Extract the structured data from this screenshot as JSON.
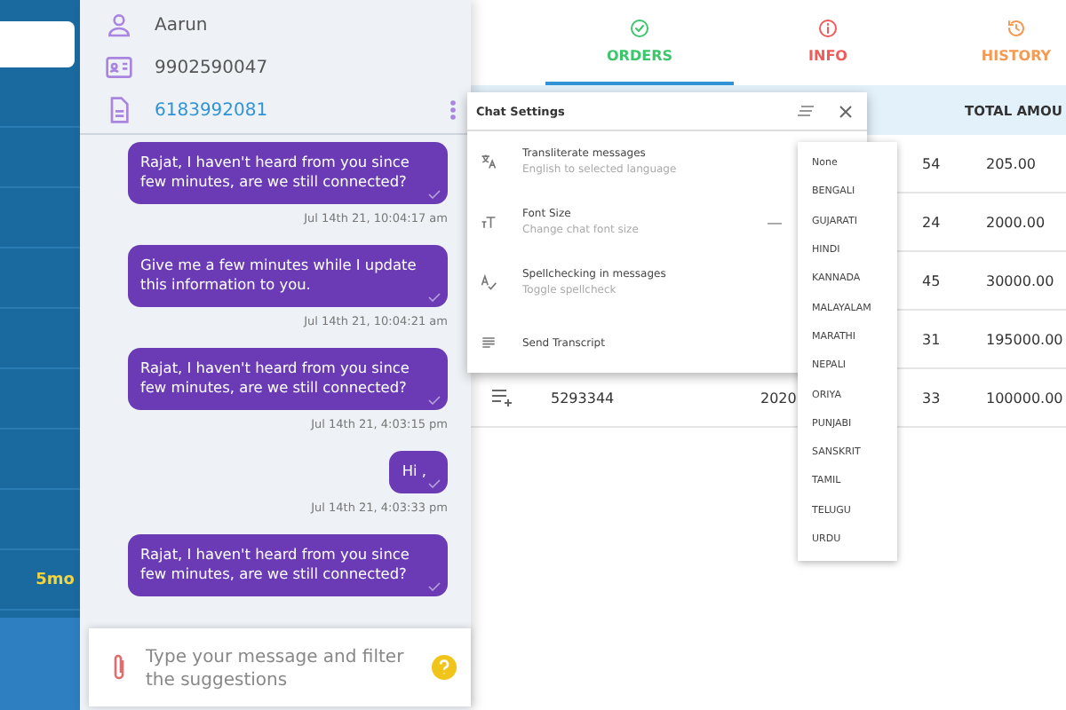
{
  "sidebar": {
    "badge_time": "5mo"
  },
  "contact": {
    "name": "Aarun",
    "phone": "9902590047",
    "account": "6183992081"
  },
  "messages": [
    {
      "text": "Rajat, I haven't heard from you since few minutes, are we still connected?",
      "time": "Jul 14th 21, 10:04:17 am"
    },
    {
      "text": "Give me a few minutes while I update this information to you.",
      "time": "Jul 14th 21, 10:04:21 am"
    },
    {
      "text": "Rajat, I haven't heard from you since few minutes, are we still connected?",
      "time": "Jul 14th 21, 4:03:15 pm"
    },
    {
      "text": "Hi ,",
      "time": "Jul 14th 21, 4:03:33 pm"
    },
    {
      "text": "Rajat, I haven't heard from you since few minutes, are we still connected?"
    }
  ],
  "composer": {
    "placeholder": "Type your message and filter the suggestions"
  },
  "tabs": [
    {
      "label": "ORDERS",
      "kind": "orders",
      "selected": true
    },
    {
      "label": "INFO",
      "kind": "info",
      "selected": false
    },
    {
      "label": "HISTORY",
      "kind": "history",
      "selected": false
    }
  ],
  "table": {
    "columns": [
      "TOTAL AMOU"
    ],
    "rows": [
      {
        "column_4": "54",
        "total": "205.00"
      },
      {
        "column_4": "24",
        "total": "2000.00"
      },
      {
        "column_4": "45",
        "total": "30000.00"
      },
      {
        "column_4": "31",
        "total": "195000.00"
      },
      {
        "order": "5293344",
        "date": "2020",
        "column_4": "33",
        "total": "100000.00"
      }
    ]
  },
  "chat_settings": {
    "title": "Chat Settings",
    "items": [
      {
        "kind": "translate",
        "title": "Transliterate messages",
        "subtitle": "English to selected language"
      },
      {
        "kind": "font",
        "title": "Font Size",
        "subtitle": "Change chat font size",
        "control": "—"
      },
      {
        "kind": "spell",
        "title": "Spellchecking in messages",
        "subtitle": "Toggle spellcheck"
      },
      {
        "kind": "transcript",
        "title": "Send Transcript"
      }
    ]
  },
  "language_menu": [
    "None",
    "BENGALI",
    "GUJARATI",
    "HINDI",
    "KANNADA",
    "MALAYALAM",
    "MARATHI",
    "NEPALI",
    "ORIYA",
    "PUNJABI",
    "SANSKRIT",
    "TAMIL",
    "TELUGU",
    "URDU"
  ]
}
